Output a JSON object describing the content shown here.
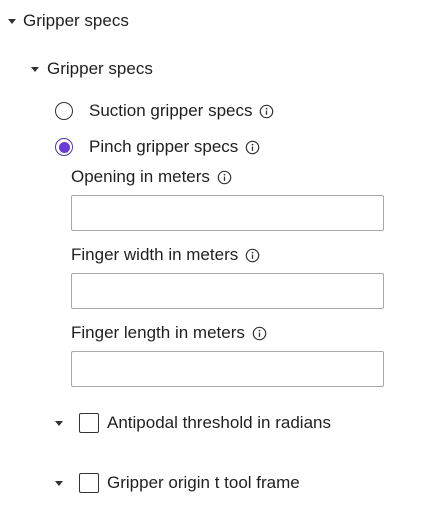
{
  "tree": {
    "root": {
      "label": "Gripper specs"
    },
    "child": {
      "label": "Gripper specs"
    }
  },
  "options": {
    "suction": {
      "label": "Suction gripper specs",
      "selected": false
    },
    "pinch": {
      "label": "Pinch gripper specs",
      "selected": true
    }
  },
  "pinch_fields": {
    "opening": {
      "label": "Opening in meters",
      "value": ""
    },
    "finger_width": {
      "label": "Finger width in meters",
      "value": ""
    },
    "finger_length": {
      "label": "Finger length in meters",
      "value": ""
    }
  },
  "optional_sections": {
    "antipodal": {
      "label": "Antipodal threshold in radians",
      "checked": false
    },
    "origin": {
      "label": "Gripper origin t tool frame",
      "checked": false
    }
  },
  "colors": {
    "accent": "#6a3bd8",
    "text": "#1f1f1f",
    "input_border": "#a8a8a8"
  }
}
